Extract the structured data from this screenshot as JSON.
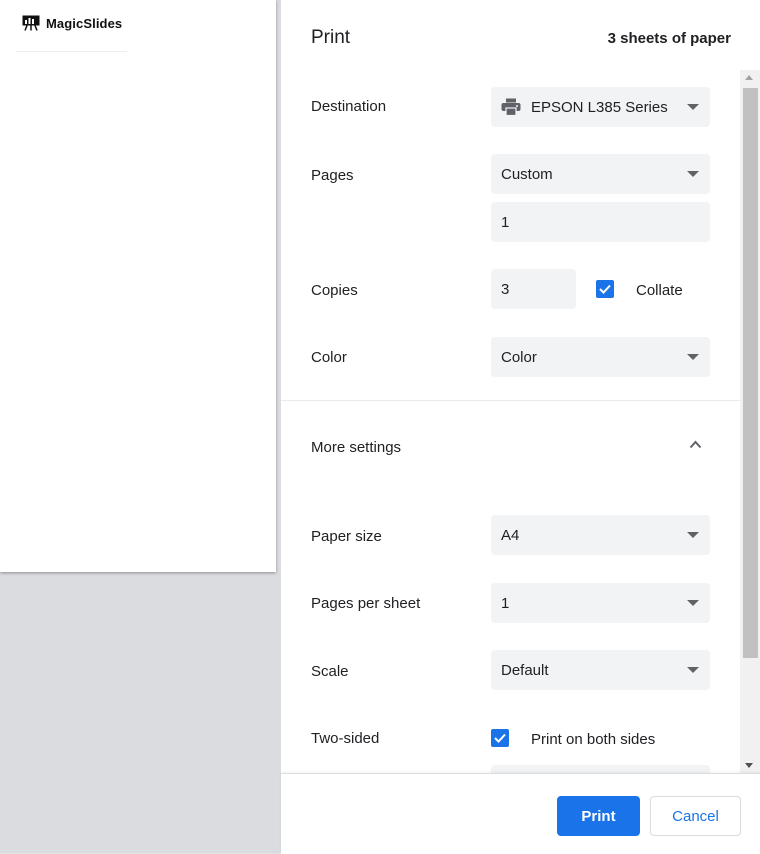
{
  "preview": {
    "logo_text": "MagicSlides",
    "logo_icon": "presentation-board-icon"
  },
  "header": {
    "title": "Print",
    "sheets": "3 sheets of paper"
  },
  "settings": {
    "destination": {
      "label": "Destination",
      "value": "EPSON L385 Series",
      "icon": "printer-icon"
    },
    "pages": {
      "label": "Pages",
      "value": "Custom",
      "custom_value": "1"
    },
    "copies": {
      "label": "Copies",
      "value": "3",
      "collate_label": "Collate",
      "collate_checked": true
    },
    "color": {
      "label": "Color",
      "value": "Color"
    },
    "more_settings": {
      "label": "More settings",
      "expanded": true
    },
    "paper_size": {
      "label": "Paper size",
      "value": "A4"
    },
    "pages_per_sheet": {
      "label": "Pages per sheet",
      "value": "1"
    },
    "scale": {
      "label": "Scale",
      "value": "Default"
    },
    "two_sided": {
      "label": "Two-sided",
      "option_label": "Print on both sides",
      "checked": true
    }
  },
  "footer": {
    "print_label": "Print",
    "cancel_label": "Cancel"
  },
  "colors": {
    "accent": "#1a73e8",
    "field_bg": "#f1f3f4",
    "preview_bg": "#dadce0"
  }
}
